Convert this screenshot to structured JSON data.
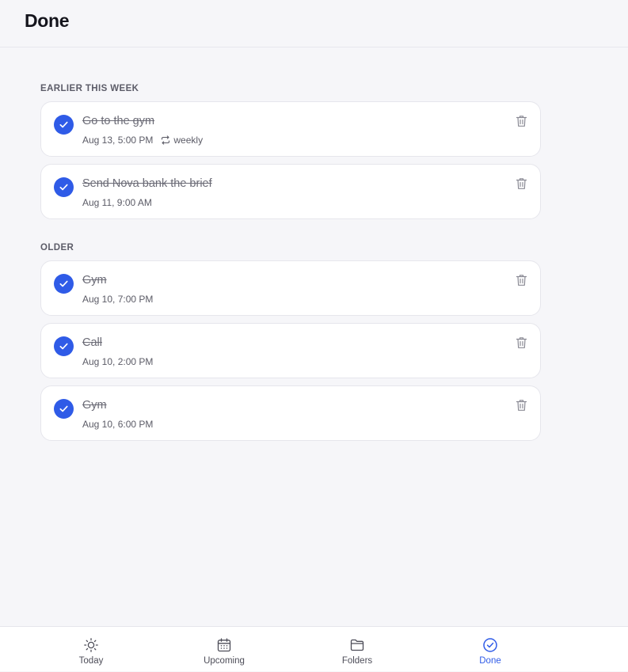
{
  "header": {
    "title": "Done"
  },
  "sections": [
    {
      "label": "EARLIER THIS WEEK",
      "tasks": [
        {
          "title": "Go to the gym",
          "time": "Aug 13, 5:00 PM",
          "repeat": "weekly"
        },
        {
          "title": "Send Nova bank the brief",
          "time": "Aug 11, 9:00 AM"
        }
      ]
    },
    {
      "label": "OLDER",
      "tasks": [
        {
          "title": "Gym",
          "time": "Aug 10, 7:00 PM"
        },
        {
          "title": "Call",
          "time": "Aug 10, 2:00 PM"
        },
        {
          "title": "Gym",
          "time": "Aug 10, 6:00 PM"
        }
      ]
    }
  ],
  "tabs": [
    {
      "label": "Today",
      "icon": "sun-icon"
    },
    {
      "label": "Upcoming",
      "icon": "calendar-icon"
    },
    {
      "label": "Folders",
      "icon": "folder-icon"
    },
    {
      "label": "Done",
      "icon": "check-circle-icon",
      "active": true
    }
  ],
  "colors": {
    "accent": "#2f5be7",
    "background": "#f6f6f9",
    "card": "#ffffff"
  }
}
